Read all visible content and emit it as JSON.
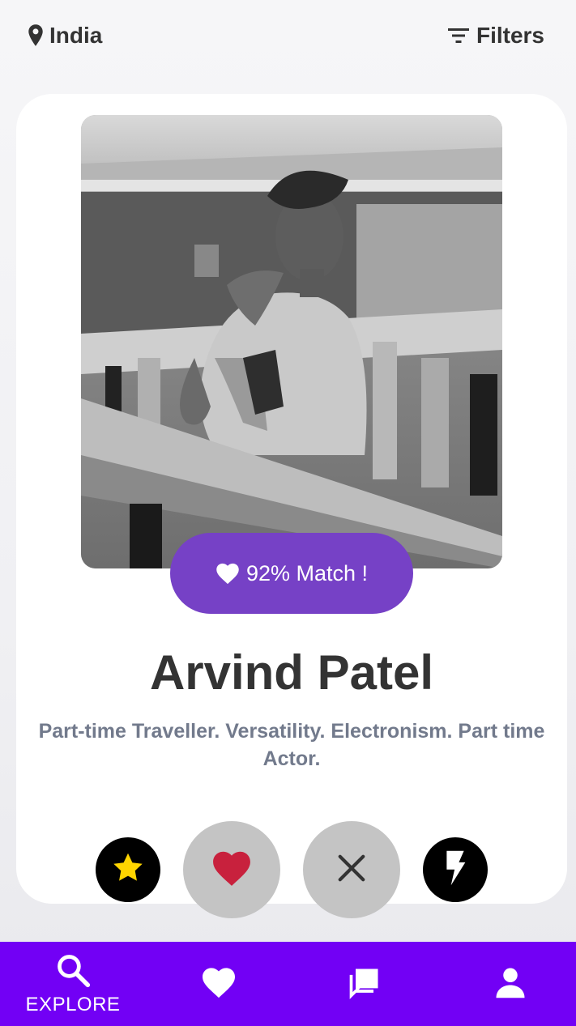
{
  "header": {
    "location": "India",
    "filters_label": "Filters"
  },
  "profile": {
    "match_text": "92% Match !",
    "name": "Arvind Patel",
    "bio": "Part-time Traveller. Versatility. Electronism. Part time Actor."
  },
  "actions": [
    {
      "name": "super-like",
      "icon": "star-icon"
    },
    {
      "name": "like",
      "icon": "heart-icon"
    },
    {
      "name": "dismiss",
      "icon": "close-icon"
    },
    {
      "name": "boost",
      "icon": "lightning-icon"
    }
  ],
  "nav": {
    "explore_label": "EXPLORE",
    "items": [
      "search-icon",
      "heart-icon",
      "chat-icon",
      "person-icon"
    ]
  },
  "colors": {
    "accent": "#7641c6",
    "nav_background": "#7200f5",
    "heart_red": "#c8213d",
    "star_yellow": "#ffd500"
  }
}
